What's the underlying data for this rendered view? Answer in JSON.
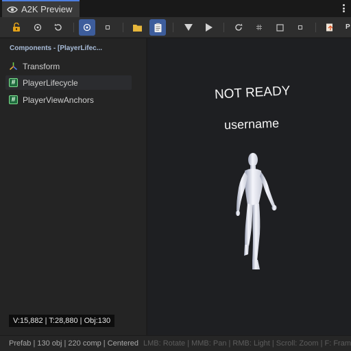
{
  "window": {
    "tab_title": "A2K Preview",
    "tab_icon": "eye-icon",
    "menu_icon": "kebab-menu-icon"
  },
  "toolbar": {
    "buttons": [
      {
        "icon": "lock-open-icon",
        "active": false
      },
      {
        "icon": "target-icon",
        "active": false
      },
      {
        "icon": "reset-icon",
        "active": false
      },
      {
        "icon": "center-pivot-icon",
        "active": true
      },
      {
        "icon": "small-square-icon",
        "active": false
      },
      {
        "icon": "folder-icon",
        "active": false
      },
      {
        "icon": "clipboard-icon",
        "active": true
      },
      {
        "icon": "play-down-icon",
        "active": false
      },
      {
        "icon": "play-icon",
        "active": false
      },
      {
        "icon": "refresh-icon",
        "active": false
      },
      {
        "icon": "grid-icon",
        "active": false
      },
      {
        "icon": "frame-square-icon",
        "active": false
      },
      {
        "icon": "small-square-icon",
        "active": false
      },
      {
        "icon": "export-icon",
        "active": false
      }
    ],
    "overflow_label": "P"
  },
  "components_panel": {
    "header": "Components - [PlayerLifec...",
    "items": [
      {
        "label": "Transform",
        "icon": "transform-axes-icon",
        "selected": false
      },
      {
        "label": "PlayerLifecycle",
        "icon": "script-hash-icon",
        "selected": true
      },
      {
        "label": "PlayerViewAnchors",
        "icon": "script-hash-icon",
        "selected": false
      }
    ]
  },
  "viewport": {
    "status_text": "NOT READY",
    "name_text": "username",
    "stats": "V:15,882 | T:28,880 | Obj:130",
    "model": "humanoid-figure"
  },
  "statusbar": {
    "left": "Prefab | 130 obj | 220 comp | Centered",
    "hints": "LMB: Rotate | MMB: Pan | RMB: Light | Scroll: Zoom | F: Frame"
  },
  "colors": {
    "accent": "#4c7ee0",
    "active_button": "#3d5d9c",
    "header_text": "#a8bcd8",
    "script_icon_bg": "#1f6b3e"
  }
}
